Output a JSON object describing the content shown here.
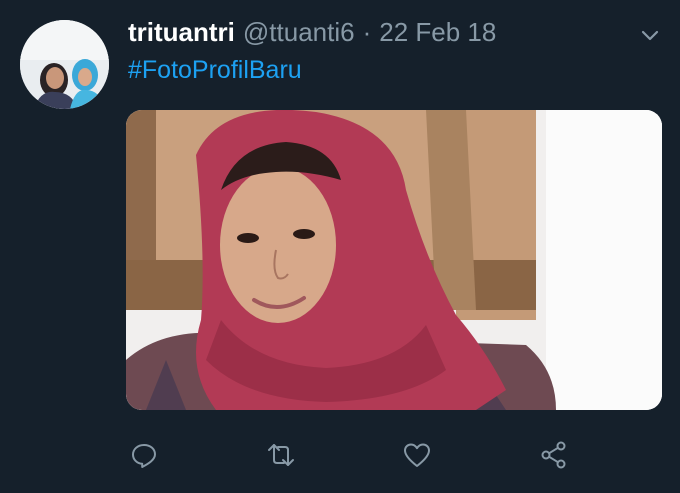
{
  "tweet": {
    "display_name": "trituantri",
    "handle": "@ttuanti6",
    "separator": "·",
    "date": "22 Feb 18",
    "text": "#FotoProfilBaru"
  },
  "icons": {
    "caret": "chevron-down-icon",
    "reply": "reply-icon",
    "retweet": "retweet-icon",
    "like": "heart-icon",
    "share": "share-icon"
  },
  "colors": {
    "background": "#15202b",
    "name": "#ffffff",
    "secondary_text": "#8899a6",
    "link": "#1da1f2"
  }
}
